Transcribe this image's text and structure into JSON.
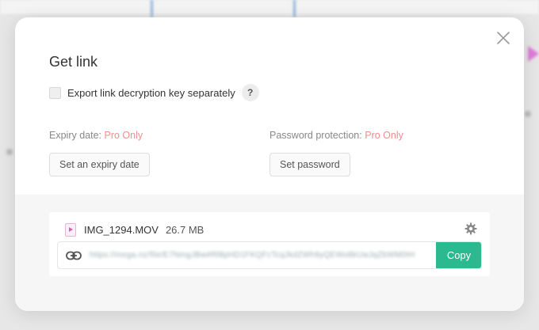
{
  "dialog": {
    "title": "Get link",
    "close_icon": "close-icon",
    "export_key": {
      "label": "Export link decryption key separately",
      "checked": false,
      "help_label": "?"
    },
    "expiry": {
      "label": "Expiry date:",
      "pro_label": "Pro Only",
      "button_label": "Set an expiry date"
    },
    "password": {
      "label": "Password protection:",
      "pro_label": "Pro Only",
      "button_label": "Set password"
    },
    "file": {
      "name": "IMG_1294.MOV",
      "size": "26.7 MB",
      "link": "https://mega.nz/file/E7NmgJBw#Rl8pHD1FKQFcTcqJkdZWh9yQEWo8kUwJqZbWM0tH",
      "copy_label": "Copy"
    }
  },
  "colors": {
    "pro_text": "#f08d8d",
    "copy_button": "#2bb98f"
  },
  "icons": [
    "close-icon",
    "help-icon",
    "video-file-icon",
    "gear-icon",
    "link-icon"
  ]
}
